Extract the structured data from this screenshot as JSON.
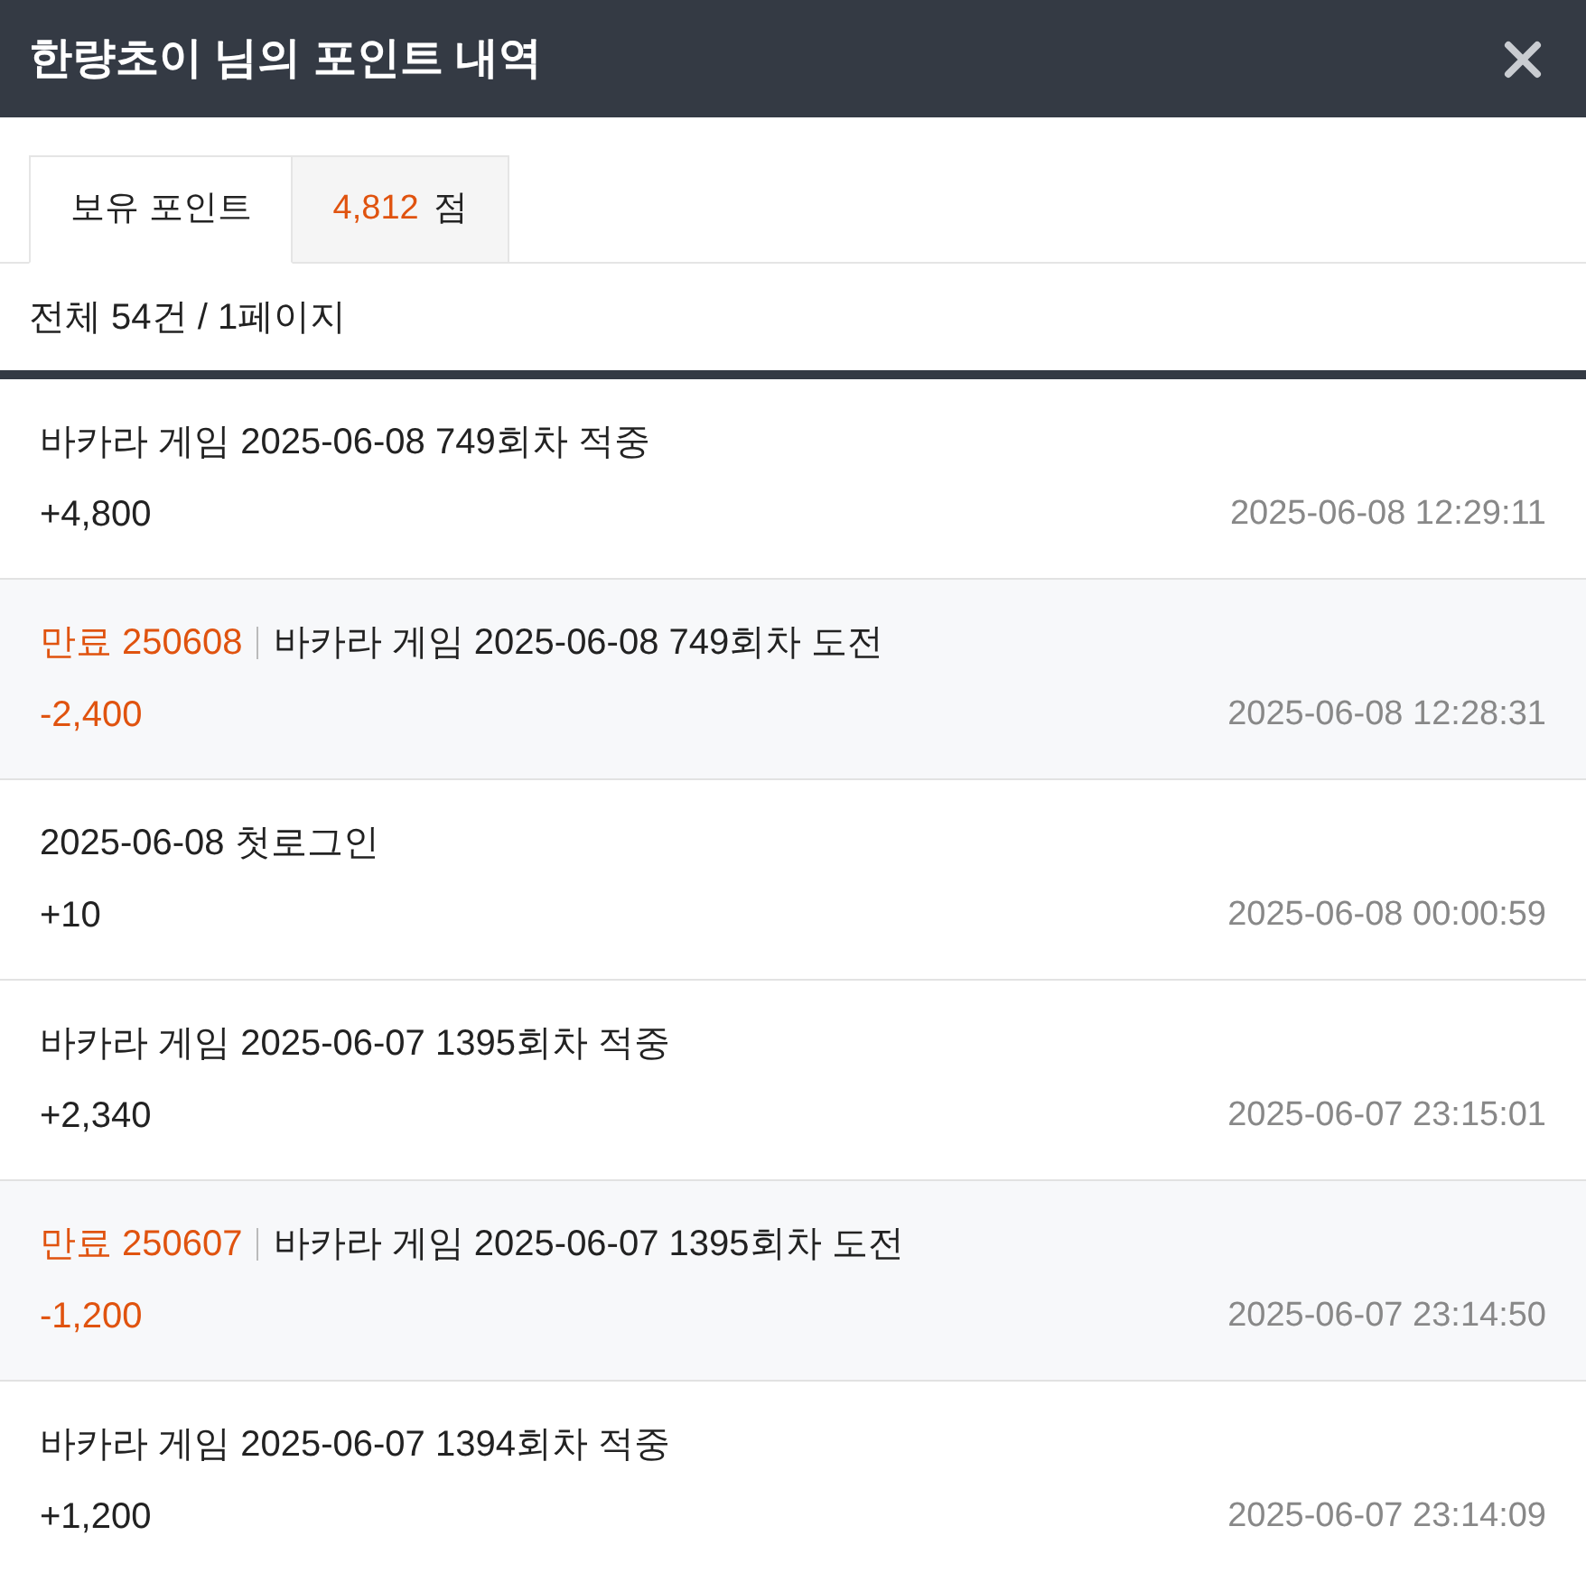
{
  "window": {
    "title": "한량초이 님의 포인트 내역"
  },
  "tabs": [
    {
      "label": "보유 포인트",
      "selected": true
    }
  ],
  "balance": {
    "amount": "4,812",
    "unit": "점"
  },
  "summary": "전체 54건 / 1페이지",
  "entries": [
    {
      "title": "바카라 게임 2025-06-08 749회차 적중",
      "kind": "credit",
      "amount": "+4,800",
      "time": "2025-06-08 12:29:11"
    },
    {
      "tag": "만료 250608",
      "title": "바카라 게임 2025-06-08 749회차 도전",
      "kind": "debit",
      "amount": "-2,400",
      "time": "2025-06-08 12:28:31"
    },
    {
      "title": "2025-06-08 첫로그인",
      "kind": "credit",
      "amount": "+10",
      "time": "2025-06-08 00:00:59"
    },
    {
      "title": "바카라 게임 2025-06-07 1395회차 적중",
      "kind": "credit",
      "amount": "+2,340",
      "time": "2025-06-07 23:15:01"
    },
    {
      "tag": "만료 250607",
      "title": "바카라 게임 2025-06-07 1395회차 도전",
      "kind": "debit",
      "amount": "-1,200",
      "time": "2025-06-07 23:14:50"
    },
    {
      "title": "바카라 게임 2025-06-07 1394회차 적중",
      "kind": "credit",
      "amount": "+1,200",
      "time": "2025-06-07 23:14:09"
    }
  ]
}
